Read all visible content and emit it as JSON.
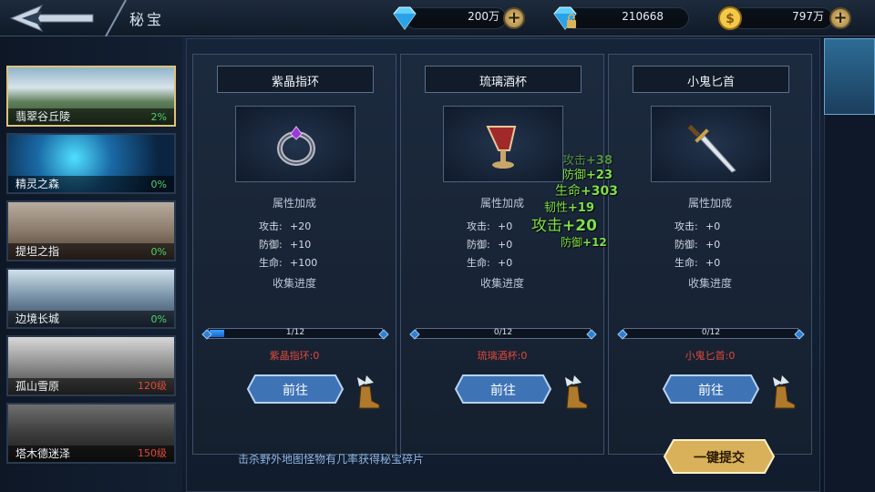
{
  "header": {
    "title": "秘宝",
    "diamonds": "200万",
    "bound_diamonds": "210668",
    "gold": "797万"
  },
  "colors": {
    "accent_gold": "#e0c27a",
    "progress_blue": "#1a64c8",
    "shard_red": "#e0483a",
    "gain_green": "#7ee04a"
  },
  "maps": [
    {
      "name": "翡翠谷丘陵",
      "value": "2%",
      "tone": "green",
      "selected": true
    },
    {
      "name": "精灵之森",
      "value": "0%",
      "tone": "green"
    },
    {
      "name": "提坦之指",
      "value": "0%",
      "tone": "green"
    },
    {
      "name": "边境长城",
      "value": "0%",
      "tone": "green"
    },
    {
      "name": "孤山雪原",
      "value": "120级",
      "tone": "red"
    },
    {
      "name": "塔木德迷泽",
      "value": "150级",
      "tone": "red"
    }
  ],
  "side_tab": {
    "label": "秘宝"
  },
  "section_labels": {
    "attr": "属性加成",
    "collect": "收集进度",
    "attack": "攻击:",
    "defense": "防御:",
    "hp": "生命:"
  },
  "cards": [
    {
      "name": "紫晶指环",
      "icon": "ring-icon",
      "attack": "+20",
      "defense": "+10",
      "hp": "+100",
      "progress": "1/12",
      "progress_fraction": 0.0833,
      "shard": "紫晶指环:0",
      "goto": "前往"
    },
    {
      "name": "琉璃酒杯",
      "icon": "goblet-icon",
      "attack": "+0",
      "defense": "+0",
      "hp": "+0",
      "progress": "0/12",
      "progress_fraction": 0,
      "shard": "琉璃酒杯:0",
      "goto": "前往"
    },
    {
      "name": "小鬼匕首",
      "icon": "dagger-icon",
      "attack": "+0",
      "defense": "+0",
      "hp": "+0",
      "progress": "0/12",
      "progress_fraction": 0,
      "shard": "小鬼匕首:0",
      "goto": "前往"
    }
  ],
  "floating_text": [
    {
      "label": "攻击",
      "value": "+38"
    },
    {
      "label": "防御",
      "value": "+23"
    },
    {
      "label": "生命",
      "value": "+303"
    },
    {
      "label": "韧性",
      "value": "+19"
    },
    {
      "label": "攻击",
      "value": "+20"
    },
    {
      "label": "防御",
      "value": "+12"
    }
  ],
  "footer": {
    "hint": "击杀野外地图怪物有几率获得秘宝碎片",
    "submit": "一键提交"
  }
}
